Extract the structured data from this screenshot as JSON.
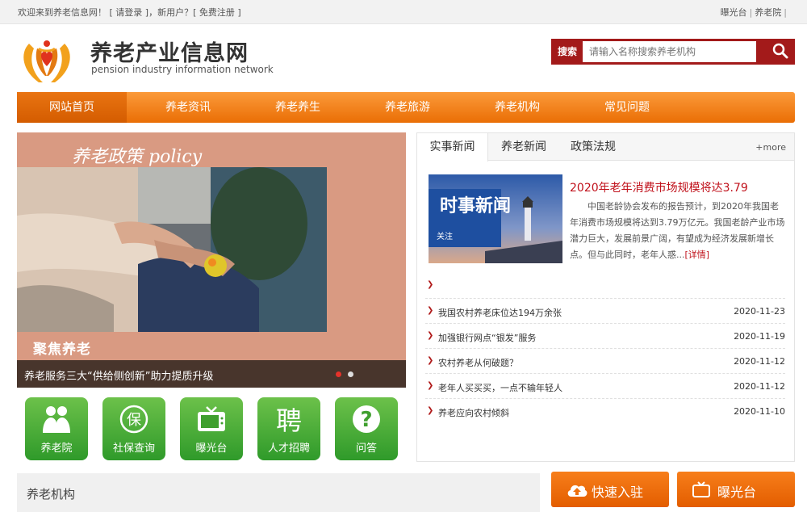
{
  "topbar": {
    "welcome": "欢迎来到养老信息网！",
    "login_bracket_open": "[",
    "login": "请登录",
    "login_bracket_close": "]",
    "new_user": "，新用户？",
    "register_bracket_open": "[",
    "register": "免费注册",
    "register_bracket_close": "]",
    "links": [
      "曝光台",
      "养老院"
    ]
  },
  "header": {
    "title": "养老产业信息网",
    "subtitle": "pension industry information network"
  },
  "search": {
    "label": "搜索",
    "placeholder": "请输入名称搜索养老机构",
    "icon": "search-icon"
  },
  "nav": {
    "items": [
      "网站首页",
      "养老资讯",
      "养老养生",
      "养老旅游",
      "养老机构",
      "常见问题"
    ],
    "active_index": 0
  },
  "banner": {
    "title": "养老政策 policy",
    "tag": "聚焦养老",
    "caption": "养老服务三大“供给侧创新”助力提质升级",
    "slide_count": 2,
    "active_slide": 0
  },
  "quick_icons": [
    {
      "label": "养老院",
      "icon": "elderly-people-icon",
      "color": "#3fa52c"
    },
    {
      "label": "社保查询",
      "icon": "bao-char-icon",
      "color": "#3fa52c"
    },
    {
      "label": "曝光台",
      "icon": "tv-icon",
      "color": "#3fa52c"
    },
    {
      "label": "人才招聘",
      "icon": "pin-char-icon",
      "color": "#3fa52c"
    },
    {
      "label": "问答",
      "icon": "question-icon",
      "color": "#3fa52c"
    }
  ],
  "news": {
    "tabs": [
      "实事新闻",
      "养老新闻",
      "政策法规"
    ],
    "active_tab": 0,
    "more": "+more",
    "featured": {
      "image_text_big": "时事新闻",
      "image_text_small": "关注",
      "title": "2020年老年消费市场规模将达3.79",
      "text": "中国老龄协会发布的报告预计，到2020年我国老年消费市场规模将达到3.79万亿元。我国老龄产业市场潜力巨大，发展前景广阔，有望成为经济发展新增长点。但与此同时，老年人惑...",
      "detail": "[详情]"
    },
    "items": [
      {
        "title": "我国农村养老床位达194万余张",
        "date": "2020-11-23"
      },
      {
        "title": "加强银行网点“银发”服务",
        "date": "2020-11-19"
      },
      {
        "title": "农村养老从何破题？",
        "date": "2020-11-12"
      },
      {
        "title": "老年人买买买，一点不输年轻人",
        "date": "2020-11-12"
      },
      {
        "title": "养老应向农村倾斜",
        "date": "2020-11-10"
      }
    ]
  },
  "bottom": {
    "section_title": "养老机构",
    "buttons": [
      {
        "label": "快速入驻",
        "icon": "cloud-upload-icon"
      },
      {
        "label": "曝光台",
        "icon": "tv-icon"
      }
    ]
  },
  "colors": {
    "accent_orange": "#f28a1e",
    "search_red": "#a31a1a",
    "news_red": "#c0101a",
    "icon_green": "#3fa52c"
  }
}
